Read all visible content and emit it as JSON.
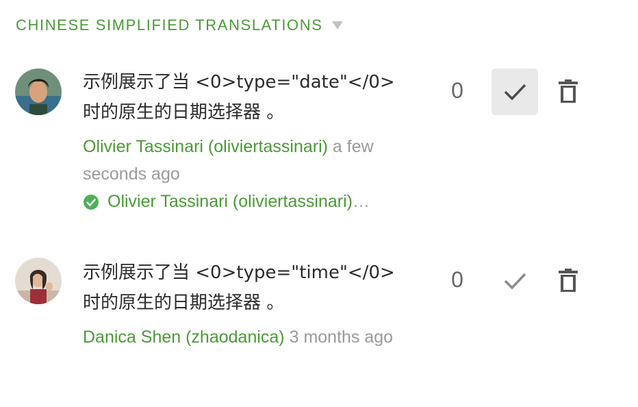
{
  "header": {
    "title": "CHINESE SIMPLIFIED TRANSLATIONS",
    "caret_icon": "triangle-down-icon"
  },
  "colors": {
    "accent": "#4a9a36",
    "muted": "#9a9a9a",
    "text": "#2b2b2b",
    "active_button_bg": "#e9e9e9"
  },
  "translations": [
    {
      "text_line1": "示例展示了当 <0>type=\"date\"</0>",
      "text_line2": "时的原生的日期选择器 。",
      "author": "Olivier Tassinari (oliviertassinari)",
      "time": "a few seconds ago",
      "approved_by": "Olivier Tassinari (oliviertassinari)",
      "votes": "0",
      "approved": true
    },
    {
      "text_line1": "示例展示了当 <0>type=\"time\"</0>",
      "text_line2": "时的原生的日期选择器 。",
      "author": "Danica Shen (zhaodanica)",
      "time": "3 months ago",
      "votes": "0",
      "approved": false
    }
  ]
}
